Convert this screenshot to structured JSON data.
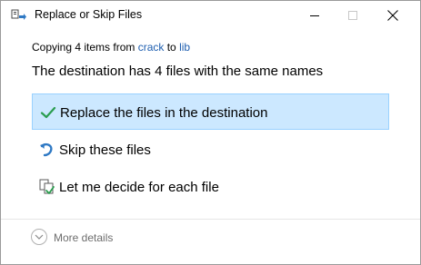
{
  "window": {
    "title": "Replace or Skip Files",
    "title_icon": "move-files-icon"
  },
  "copy_info": {
    "prefix": "Copying 4 items from ",
    "source": "crack",
    "middle": " to ",
    "destination": "lib"
  },
  "heading": "The destination has 4 files with the same names",
  "options": [
    {
      "label": "Replace the files in the destination",
      "icon": "checkmark-icon",
      "selected": true
    },
    {
      "label": "Skip these files",
      "icon": "skip-arrow-icon",
      "selected": false
    },
    {
      "label": "Let me decide for each file",
      "icon": "compare-files-icon",
      "selected": false
    }
  ],
  "footer": {
    "details_label": "More details",
    "details_icon": "chevron-down-icon"
  },
  "colors": {
    "selected_bg": "#cce8ff",
    "selected_border": "#99d1ff",
    "link": "#1f5fb0",
    "check": "#2a9d4f",
    "skip_arrow": "#2f79c4"
  }
}
